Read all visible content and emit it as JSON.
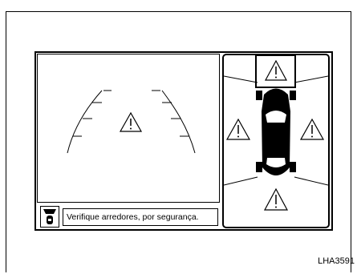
{
  "status_bar": {
    "message": "Verifique arredores, por segurança.",
    "camera_button_icon": "camera-view-icon"
  },
  "rear_view": {
    "warning_icon": "warning-triangle-icon"
  },
  "around_view": {
    "warning_icons": [
      "front-warning-icon",
      "left-warning-icon",
      "right-warning-icon",
      "rear-warning-icon"
    ],
    "vehicle_icon": "car-top-view-icon"
  },
  "figure": {
    "code": "LHA3591"
  }
}
